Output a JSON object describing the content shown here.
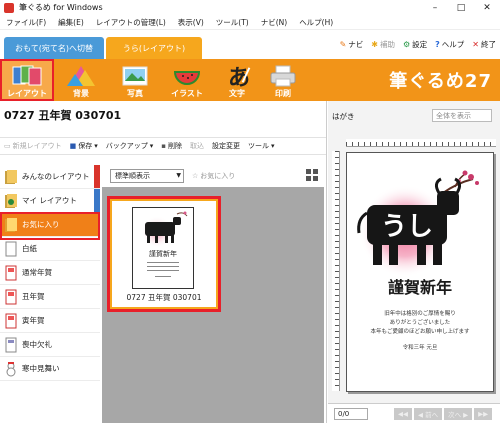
{
  "window": {
    "title": "筆ぐるめ for Windows",
    "controls": [
      "–",
      "□",
      "✕"
    ]
  },
  "menu": [
    "ファイル(F)",
    "編集(E)",
    "レイアウトの管理(L)",
    "表示(V)",
    "ツール(T)",
    "ナビ(N)",
    "ヘルプ(H)"
  ],
  "tabs": {
    "front": "おもて(宛て名)へ切替",
    "back": "うら(レイアウト)"
  },
  "nav_links": [
    {
      "icon": "pin-icon",
      "label": "ナビ",
      "glyph": "✎"
    },
    {
      "icon": "star-icon",
      "label": "補助",
      "glyph": "✱"
    },
    {
      "icon": "gear-icon",
      "label": "設定",
      "glyph": "⚙"
    },
    {
      "icon": "help-icon",
      "label": "ヘルプ",
      "glyph": "?"
    },
    {
      "icon": "close-icon",
      "label": "終了",
      "glyph": "✕"
    }
  ],
  "toolbar": {
    "tools": [
      "レイアウト",
      "背景",
      "写真",
      "イラスト",
      "文字",
      "印刷"
    ],
    "selected": "レイアウト",
    "brand": "筆ぐるめ27",
    "accent_color": "#f29418",
    "highlight_color": "#e8202a"
  },
  "layout": {
    "title": "0727 丑年賀 030701"
  },
  "actions": [
    {
      "label": "新規レイアウト",
      "disabled": true
    },
    {
      "label": "保存",
      "disabled": false
    },
    {
      "label": "バックアップ",
      "disabled": false
    },
    {
      "label": "削除",
      "disabled": false
    },
    {
      "label": "取込",
      "disabled": true
    },
    {
      "label": "設定変更",
      "disabled": false
    },
    {
      "label": "ツール",
      "disabled": false
    }
  ],
  "categories": [
    {
      "label": "みんなのレイアウト"
    },
    {
      "label": "マイ レイアウト"
    },
    {
      "label": "お気に入り"
    },
    {
      "label": "白紙"
    },
    {
      "label": "通常年賀"
    },
    {
      "label": "丑年賀"
    },
    {
      "label": "寅年賀"
    },
    {
      "label": "喪中欠礼"
    },
    {
      "label": "寒中見舞い"
    }
  ],
  "selected_category": "お気に入り",
  "gallery": {
    "sort": "標準順表示",
    "fav_label": "お気に入り",
    "thumbnail_caption": "0727 丑年賀 030701"
  },
  "preview": {
    "paper": "はがき",
    "view_option": "全体を表示",
    "card_big_text": "うし",
    "card_title": "謹賀新年",
    "card_message": [
      "旧年中は格別のご厚情を賜り",
      "ありがとうございました",
      "本年もご愛顧のほどお願い申し上げます"
    ],
    "card_date": "令和三年 元旦",
    "page_counter": "0/0",
    "pager": [
      "◀◀",
      "◀ 前へ",
      "次へ ▶",
      "▶▶"
    ]
  }
}
